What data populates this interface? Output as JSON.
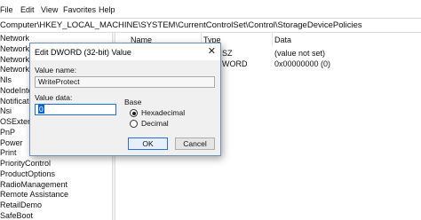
{
  "menu": [
    "File",
    "Edit",
    "View",
    "Favorites",
    "Help"
  ],
  "address": "Computer\\HKEY_LOCAL_MACHINE\\SYSTEM\\CurrentControlSet\\Control\\StorageDevicePolicies",
  "tree": [
    "Network",
    "NetworkP",
    "NetworkS",
    "NetworkU",
    "Nls",
    "NodeInter",
    "Notificati",
    "Nsi",
    "OSExtensi",
    "PnP",
    "Power",
    "Print",
    "PriorityControl",
    "ProductOptions",
    "RadioManagement",
    "Remote Assistance",
    "RetailDemo",
    "SafeBoot"
  ],
  "columns": {
    "name": "Name",
    "type": "Type",
    "data": "Data"
  },
  "rows": [
    {
      "type_partial": "SZ",
      "data": "(value not set)"
    },
    {
      "type_partial": "WORD",
      "data": "0x00000000 (0)"
    }
  ],
  "dialog": {
    "title": "Edit DWORD (32-bit) Value",
    "close_glyph": "✕",
    "value_name_label": "Value name:",
    "value_name": "WriteProtect",
    "value_data_label": "Value data:",
    "value_data": "0",
    "base_label": "Base",
    "hex_label": "Hexadecimal",
    "dec_label": "Decimal",
    "ok_label": "OK",
    "cancel_label": "Cancel",
    "selected_base": "Hexadecimal"
  }
}
